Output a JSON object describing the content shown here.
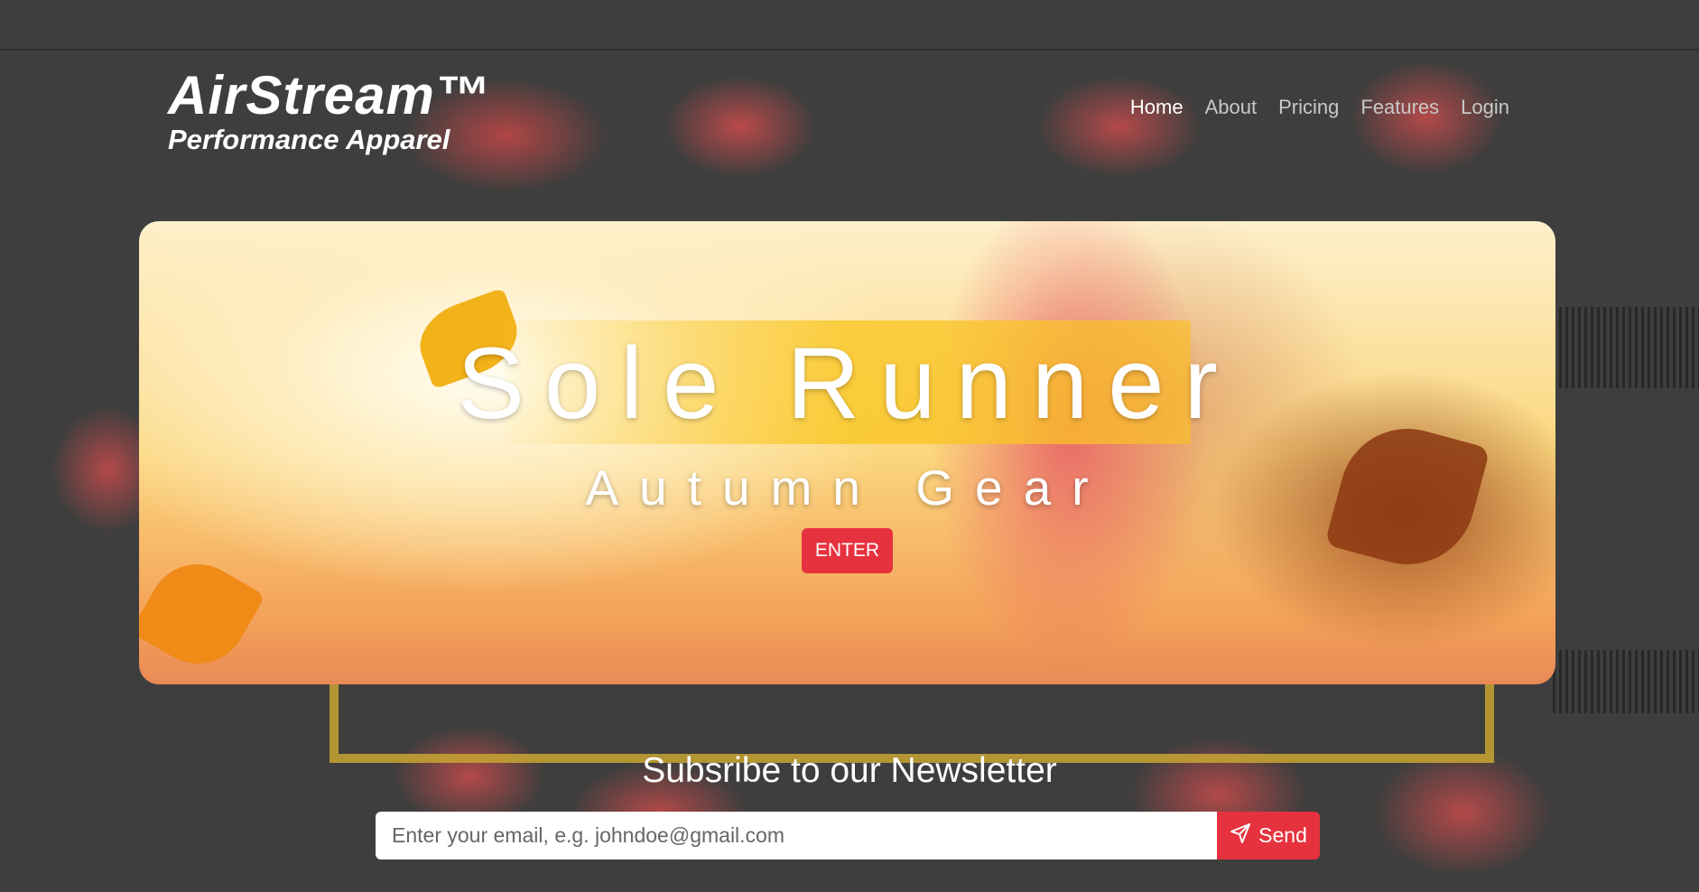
{
  "brand": {
    "name": "AirStream™",
    "tagline": "Performance Apparel"
  },
  "nav": {
    "items": [
      {
        "label": "Home",
        "active": true
      },
      {
        "label": "About"
      },
      {
        "label": "Pricing"
      },
      {
        "label": "Features"
      },
      {
        "label": "Login"
      }
    ]
  },
  "hero": {
    "title": "Sole Runner",
    "subtitle": "Autumn Gear",
    "cta_label": "ENTER"
  },
  "newsletter": {
    "title": "Subsribe to our Newsletter",
    "email_placeholder": "Enter your email, e.g. johndoe@gmail.com",
    "send_label": "Send",
    "send_icon": "paper-plane-icon"
  },
  "colors": {
    "accent": "#e6323e",
    "nav_active": "#ffffff",
    "nav_inactive": "#c8c8c8"
  }
}
